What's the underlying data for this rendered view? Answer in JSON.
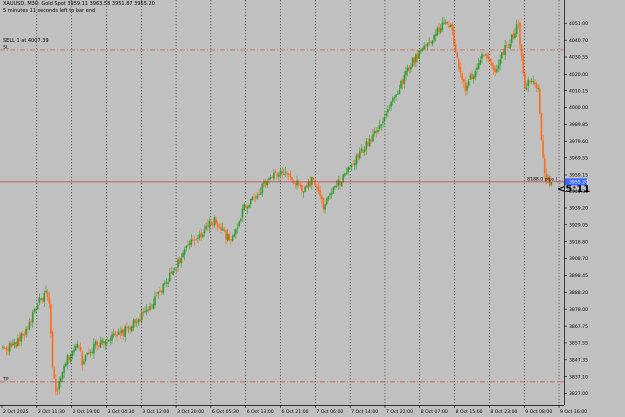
{
  "header": {
    "symbol_line": "XAUUSD, M30: Gold Spot  3959.11 3963.58 3951.87 3955.20",
    "timer_line": "5 minutes 11 seconds left to bar end",
    "order_line": "SELL 1 at 4007.39"
  },
  "levels": {
    "sl_label": "SL",
    "tp_label": "TP",
    "sl_price": 4034.8,
    "tp_price": 3834.0,
    "order_price": 3955.0,
    "price_box": "3955.20",
    "countdown": "<5:11",
    "order_text": "8188.0 pips | ..."
  },
  "colors": {
    "background": "#c0c0c0",
    "bull": "#2f9e2f",
    "bear": "#ff6a1a",
    "sl_tp_line": "#d04a3a",
    "order_line": "#c04040",
    "price_box": "#3a66ff",
    "grid": "#000000"
  },
  "chart_data": {
    "type": "candlestick",
    "symbol": "XAUUSD",
    "timeframe": "M30",
    "ylim": [
      3820,
      4062
    ],
    "y_ticks": [
      "4051.00",
      "4040.70",
      "4030.55",
      "4020.00",
      "4010.15",
      "4000.00",
      "3989.85",
      "3979.60",
      "3969.55",
      "3959.15",
      "3949.30",
      "3939.20",
      "3929.05",
      "3918.80",
      "3908.70",
      "3898.45",
      "3888.20",
      "3878.00",
      "3867.75",
      "3857.55",
      "3847.35",
      "3837.10",
      "3827.00"
    ],
    "x_labels": [
      "2 Oct 2025",
      "2 Oct 11:30",
      "2 Oct 19:00",
      "3 Oct 04:30",
      "3 Oct 12:00",
      "3 Oct 20:00",
      "6 Oct 05:30",
      "6 Oct 13:00",
      "6 Oct 21:00",
      "7 Oct 06:00",
      "7 Oct 14:00",
      "7 Oct 22:00",
      "8 Oct 07:00",
      "8 Oct 15:00",
      "8 Oct 23:00",
      "9 Oct 08:00",
      "9 Oct 16:00"
    ],
    "anchors": [
      [
        0,
        3854
      ],
      [
        8,
        3857
      ],
      [
        14,
        3865
      ],
      [
        20,
        3880
      ],
      [
        26,
        3888
      ],
      [
        28,
        3880
      ],
      [
        30,
        3842
      ],
      [
        32,
        3828
      ],
      [
        34,
        3832
      ],
      [
        38,
        3846
      ],
      [
        42,
        3853
      ],
      [
        46,
        3856
      ],
      [
        48,
        3846
      ],
      [
        52,
        3853
      ],
      [
        60,
        3859
      ],
      [
        70,
        3862
      ],
      [
        80,
        3870
      ],
      [
        90,
        3880
      ],
      [
        98,
        3893
      ],
      [
        104,
        3903
      ],
      [
        112,
        3916
      ],
      [
        120,
        3924
      ],
      [
        128,
        3932
      ],
      [
        134,
        3924
      ],
      [
        138,
        3918
      ],
      [
        146,
        3940
      ],
      [
        154,
        3948
      ],
      [
        162,
        3958
      ],
      [
        170,
        3961
      ],
      [
        176,
        3955
      ],
      [
        182,
        3950
      ],
      [
        188,
        3957
      ],
      [
        192,
        3945
      ],
      [
        194,
        3940
      ],
      [
        198,
        3947
      ],
      [
        206,
        3958
      ],
      [
        214,
        3969
      ],
      [
        222,
        3980
      ],
      [
        230,
        3993
      ],
      [
        238,
        4008
      ],
      [
        246,
        4025
      ],
      [
        254,
        4036
      ],
      [
        262,
        4044
      ],
      [
        268,
        4053
      ],
      [
        272,
        4046
      ],
      [
        276,
        4022
      ],
      [
        280,
        4012
      ],
      [
        286,
        4022
      ],
      [
        292,
        4034
      ],
      [
        298,
        4022
      ],
      [
        302,
        4032
      ],
      [
        308,
        4042
      ],
      [
        312,
        4050
      ],
      [
        316,
        4012
      ],
      [
        320,
        4018
      ],
      [
        324,
        4010
      ],
      [
        326,
        3980
      ],
      [
        328,
        3958
      ],
      [
        332,
        3954
      ]
    ]
  }
}
